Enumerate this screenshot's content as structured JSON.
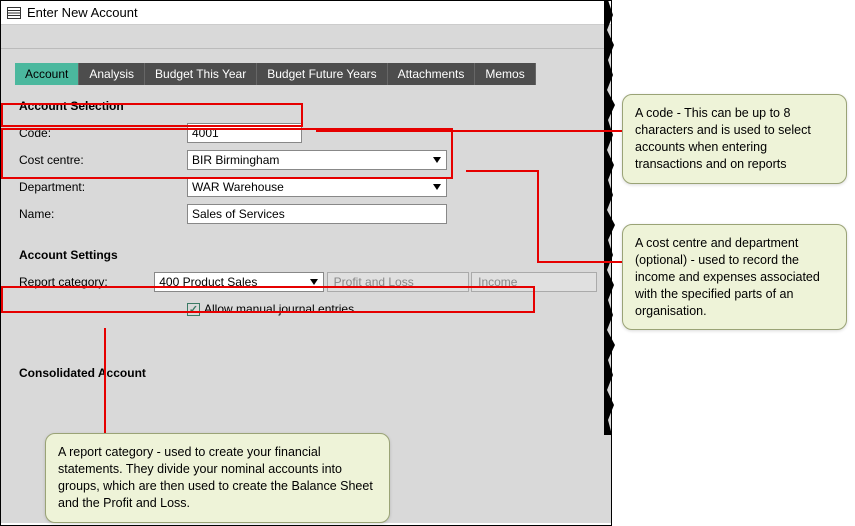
{
  "window": {
    "title": "Enter New Account"
  },
  "tabs": [
    {
      "label": "Account",
      "active": true
    },
    {
      "label": "Analysis"
    },
    {
      "label": "Budget This Year"
    },
    {
      "label": "Budget Future Years"
    },
    {
      "label": "Attachments"
    },
    {
      "label": "Memos"
    }
  ],
  "section_selection": "Account Selection",
  "fields": {
    "code_label": "Code:",
    "code_value": "4001",
    "cost_centre_label": "Cost centre:",
    "cost_centre_value": "BIR Birmingham",
    "department_label": "Department:",
    "department_value": "WAR Warehouse",
    "name_label": "Name:",
    "name_value": "Sales of Services"
  },
  "section_settings": "Account Settings",
  "settings": {
    "report_category_label": "Report category:",
    "report_category_value": "400 Product Sales",
    "pnl_box": "Profit and Loss",
    "income_box": "Income",
    "allow_manual_label": "Allow manual journal entries",
    "allow_manual_checked": true
  },
  "section_consolidated": "Consolidated Account",
  "callouts": {
    "code": " A code - This can be up to 8 characters and is used to select accounts when entering transactions and on reports",
    "ccdept": " A cost centre and department (optional) - used to record the income and expenses associated with the specified parts of an organisation.",
    "report": " A report category - used to create your financial statements. They divide your nominal accounts into groups, which are then used to create the Balance Sheet and the Profit and Loss."
  }
}
